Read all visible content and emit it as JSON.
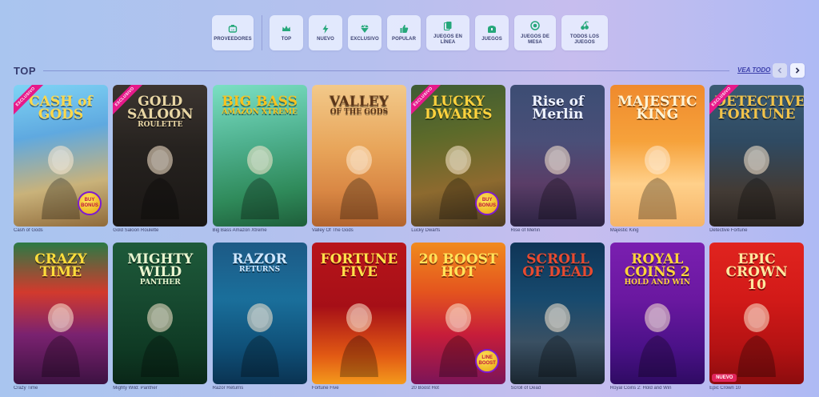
{
  "categories": [
    {
      "id": "providers",
      "label": "PROVEEDORES",
      "icon": "provider-chest-icon",
      "width": 52
    },
    {
      "id": "top",
      "label": "TOP",
      "icon": "crown-icon",
      "width": 42
    },
    {
      "id": "new",
      "label": "NUEVO",
      "icon": "lightning-icon",
      "width": 42
    },
    {
      "id": "exclusive",
      "label": "EXCLUSIVO",
      "icon": "diamond-icon",
      "width": 42
    },
    {
      "id": "popular",
      "label": "POPULAR",
      "icon": "thumbs-up-icon",
      "width": 42
    },
    {
      "id": "online",
      "label": "JUEGOS EN LÍNEA",
      "icon": "cards-icon",
      "width": 54
    },
    {
      "id": "games",
      "label": "JUEGOS",
      "icon": "treasure-chest-icon",
      "width": 42
    },
    {
      "id": "table",
      "label": "JUEGOS DE MESA",
      "icon": "roulette-icon",
      "width": 52
    },
    {
      "id": "all",
      "label": "TODOS LOS JUEGOS",
      "icon": "cherries-icon",
      "width": 58
    }
  ],
  "section": {
    "title": "TOP",
    "see_all": "VEA TODO"
  },
  "colors": {
    "accent": "#3c3faa",
    "exclusive_ribbon": "#e6198a",
    "new_badge": "#e0245a"
  },
  "games": [
    {
      "name": "Cash of Gods",
      "art_title": "CASH of GODS",
      "art_sub": "",
      "ribbon": "EXCLUSIVO",
      "badge": "",
      "corner": "BUY BONUS",
      "bg": "linear-gradient(170deg,#7fd4f5 0%,#5fa9e0 35%,#c9b27a 70%,#8f6a3a 100%)",
      "title_color": "#ffd84a"
    },
    {
      "name": "Gold Saloon Roulette",
      "art_title": "GOLD SALOON",
      "art_sub": "ROULETTE",
      "ribbon": "EXCLUSIVO",
      "badge": "",
      "corner": "",
      "bg": "linear-gradient(180deg,#3c3530 0%,#26221f 45%,#1a1715 100%)",
      "title_color": "#e8d6a4"
    },
    {
      "name": "Big Bass Amazon Xtreme",
      "art_title": "BIG BASS",
      "art_sub": "AMAZON XTREME",
      "ribbon": "",
      "badge": "",
      "corner": "",
      "bg": "linear-gradient(170deg,#7be0c4 0%,#4fb18f 40%,#2f8a5a 75%,#1e5e3a 100%)",
      "title_color": "#f7c21e"
    },
    {
      "name": "Valley Of The Gods",
      "art_title": "VALLEY",
      "art_sub": "OF THE GODS",
      "ribbon": "",
      "badge": "",
      "corner": "",
      "bg": "linear-gradient(180deg,#f2c98a 0%,#e8a55a 45%,#d98744 75%,#b2642d 100%)",
      "title_color": "#5a3417"
    },
    {
      "name": "Lucky Dwarfs",
      "art_title": "LUCKY DWARFS",
      "art_sub": "",
      "ribbon": "EXCLUSIVO",
      "badge": "",
      "corner": "BUY BONUS",
      "bg": "linear-gradient(170deg,#3e5b34 0%,#5c6a2a 35%,#8d6a2f 70%,#4b3a22 100%)",
      "title_color": "#ffd23d"
    },
    {
      "name": "Rise of Merlin",
      "art_title": "Rise of Merlin",
      "art_sub": "",
      "ribbon": "",
      "badge": "",
      "corner": "",
      "bg": "linear-gradient(180deg,#3c4d74 0%,#4a4f78 40%,#5a3d67 70%,#2c2343 100%)",
      "title_color": "#eef2ff"
    },
    {
      "name": "Majestic King",
      "art_title": "MAJESTIC KING",
      "art_sub": "",
      "ribbon": "",
      "badge": "",
      "corner": "",
      "bg": "linear-gradient(180deg,#ef8a2d 0%,#f6a23b 40%,#ffd08a 70%,#f5b468 100%)",
      "title_color": "#fff4d6"
    },
    {
      "name": "Detective Fortune",
      "art_title": "DETECTIVE FORTUNE",
      "art_sub": "",
      "ribbon": "EXCLUSIVO",
      "badge": "",
      "corner": "",
      "bg": "linear-gradient(180deg,#3a5b74 0%,#2f4a62 40%,#433b35 75%,#2a2420 100%)",
      "title_color": "#f2c34a"
    },
    {
      "name": "Crazy Time",
      "art_title": "CRAZY TIME",
      "art_sub": "",
      "ribbon": "",
      "badge": "",
      "corner": "",
      "bg": "linear-gradient(180deg,#2a7a45 0%,#d23a2d 35%,#7a2270 65%,#3d1242 100%)",
      "title_color": "#ffdd3b"
    },
    {
      "name": "Mighty Wild: Panther",
      "art_title": "MIGHTY WILD",
      "art_sub": "PANTHER",
      "ribbon": "",
      "badge": "",
      "corner": "",
      "bg": "linear-gradient(180deg,#1e5a3a 0%,#174a30 40%,#0f3a24 75%,#0a2718 100%)",
      "title_color": "#e9f5cf"
    },
    {
      "name": "Razor Returns",
      "art_title": "RAZOR",
      "art_sub": "RETURNS",
      "ribbon": "",
      "badge": "",
      "corner": "",
      "bg": "linear-gradient(180deg,#1d5a86 0%,#1a6f9b 40%,#0f4f77 75%,#0a3352 100%)",
      "title_color": "#cfe7ff"
    },
    {
      "name": "Fortune Five",
      "art_title": "FORTUNE FIVE",
      "art_sub": "",
      "ribbon": "",
      "badge": "",
      "corner": "",
      "bg": "linear-gradient(180deg,#b8151b 0%,#a60f17 45%,#e25a14 80%,#f49a1c 100%)",
      "title_color": "#ffe14a"
    },
    {
      "name": "20 Boost Hot",
      "art_title": "20 BOOST HOT",
      "art_sub": "",
      "ribbon": "",
      "badge": "",
      "corner": "LINE BOOST",
      "bg": "linear-gradient(180deg,#f08a1e 0%,#e4541e 35%,#c71d3a 65%,#7b1458 100%)",
      "title_color": "#ffe45a"
    },
    {
      "name": "Scroll of Dead",
      "art_title": "SCROLL OF DEAD",
      "art_sub": "",
      "ribbon": "",
      "badge": "",
      "corner": "",
      "bg": "linear-gradient(180deg,#0f3557 0%,#174a6e 40%,#3a5063 70%,#1a2630 100%)",
      "title_color": "#e84a2f"
    },
    {
      "name": "Royal Coins 2: Hold and Win",
      "art_title": "ROYAL COINS 2",
      "art_sub": "HOLD AND WIN",
      "ribbon": "",
      "badge": "",
      "corner": "",
      "bg": "linear-gradient(180deg,#7a1fb0 0%,#6a18a0 40%,#4a1187 75%,#2f0b63 100%)",
      "title_color": "#ffd43a"
    },
    {
      "name": "Epic Crown 10",
      "art_title": "EPIC CROWN 10",
      "art_sub": "",
      "ribbon": "",
      "badge": "NUEVO",
      "corner": "",
      "bg": "linear-gradient(180deg,#e0241f 0%,#d21a18 40%,#b31213 75%,#8c0c0e 100%)",
      "title_color": "#ffe9a0"
    }
  ]
}
